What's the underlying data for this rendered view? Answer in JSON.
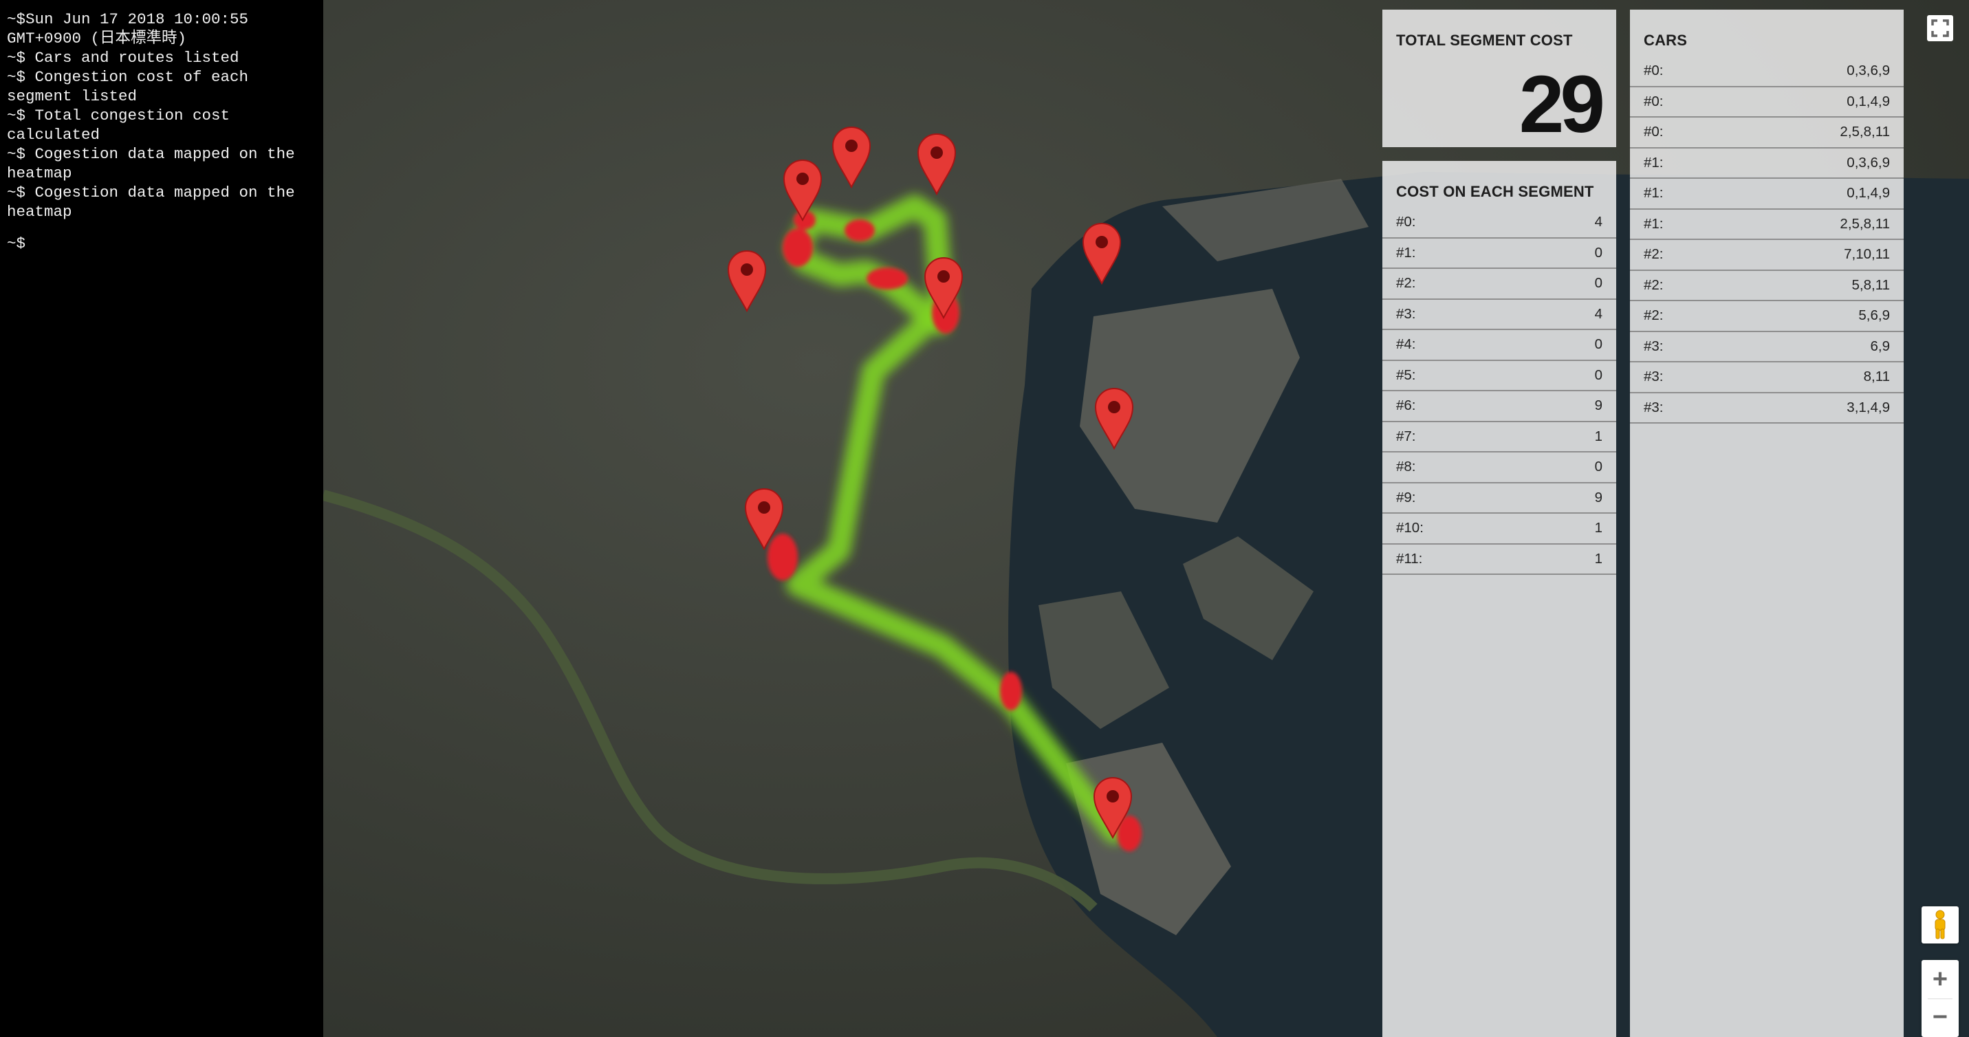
{
  "terminal": {
    "lines": [
      "~$Sun Jun 17 2018 10:00:55 GMT+0900 (日本標準時)",
      "~$ Cars and routes listed",
      "~$ Congestion cost of each segment listed",
      "~$ Total congestion cost calculated",
      "~$ Cogestion data mapped on the heatmap",
      "~$ Cogestion data mapped on the heatmap"
    ],
    "prompt": "~$"
  },
  "total": {
    "title": "TOTAL SEGMENT COST",
    "value": "29"
  },
  "segments": {
    "title": "COST ON EACH SEGMENT",
    "rows": [
      {
        "label": "#0:",
        "value": "4"
      },
      {
        "label": "#1:",
        "value": "0"
      },
      {
        "label": "#2:",
        "value": "0"
      },
      {
        "label": "#3:",
        "value": "4"
      },
      {
        "label": "#4:",
        "value": "0"
      },
      {
        "label": "#5:",
        "value": "0"
      },
      {
        "label": "#6:",
        "value": "9"
      },
      {
        "label": "#7:",
        "value": "1"
      },
      {
        "label": "#8:",
        "value": "0"
      },
      {
        "label": "#9:",
        "value": "9"
      },
      {
        "label": "#10:",
        "value": "1"
      },
      {
        "label": "#11:",
        "value": "1"
      }
    ]
  },
  "cars": {
    "title": "CARS",
    "rows": [
      {
        "label": "#0:",
        "value": "0,3,6,9"
      },
      {
        "label": "#0:",
        "value": "0,1,4,9"
      },
      {
        "label": "#0:",
        "value": "2,5,8,11"
      },
      {
        "label": "#1:",
        "value": "0,3,6,9"
      },
      {
        "label": "#1:",
        "value": "0,1,4,9"
      },
      {
        "label": "#1:",
        "value": "2,5,8,11"
      },
      {
        "label": "#2:",
        "value": "7,10,11"
      },
      {
        "label": "#2:",
        "value": "5,8,11"
      },
      {
        "label": "#2:",
        "value": "5,6,9"
      },
      {
        "label": "#3:",
        "value": "6,9"
      },
      {
        "label": "#3:",
        "value": "8,11"
      },
      {
        "label": "#3:",
        "value": "3,1,4,9"
      }
    ]
  },
  "map": {
    "colors": {
      "route": "#7ed321",
      "congestion": "#e0202a",
      "marker": "#e53935",
      "water": "#1c2a32",
      "land": "#3b3f38"
    },
    "controls": {
      "zoom_in": "+",
      "zoom_out": "−"
    }
  }
}
